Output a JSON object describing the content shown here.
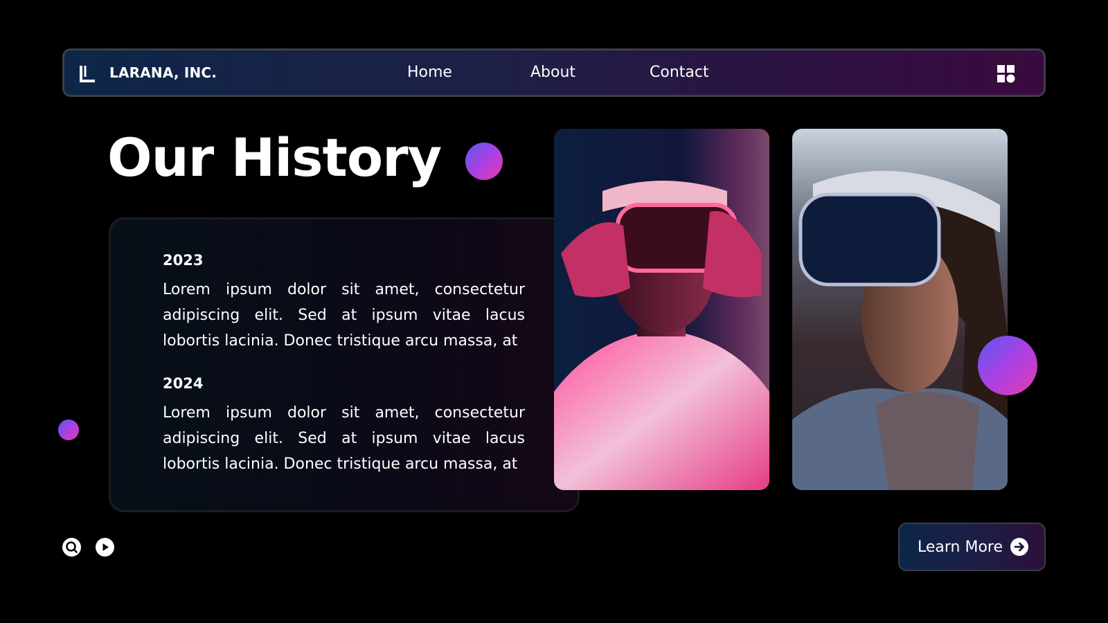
{
  "nav": {
    "brand": "LARANA, INC.",
    "links": [
      {
        "label": "Home"
      },
      {
        "label": "About"
      },
      {
        "label": "Contact"
      }
    ],
    "menu_icon": "grid-icon"
  },
  "title": "Our History",
  "history": [
    {
      "year": "2023",
      "text": "Lorem ipsum dolor sit amet, consectetur adipiscing elit. Sed at ipsum vitae lacus lobortis lacinia. Donec tristique arcu massa, at"
    },
    {
      "year": "2024",
      "text": "Lorem ipsum dolor sit amet, consectetur adipiscing elit. Sed at ipsum vitae lacus lobortis lacinia. Donec tristique arcu massa, at"
    }
  ],
  "footer_icons": [
    "search-icon",
    "play-icon"
  ],
  "cta": {
    "label": "Learn More",
    "icon": "arrow-right-icon"
  },
  "colors": {
    "accent_gradient": [
      "#5a5bf0",
      "#b13ee0",
      "#e23ea8"
    ],
    "nav_gradient": [
      "#0d2648",
      "#3a0a3f"
    ],
    "background": "#000000"
  }
}
